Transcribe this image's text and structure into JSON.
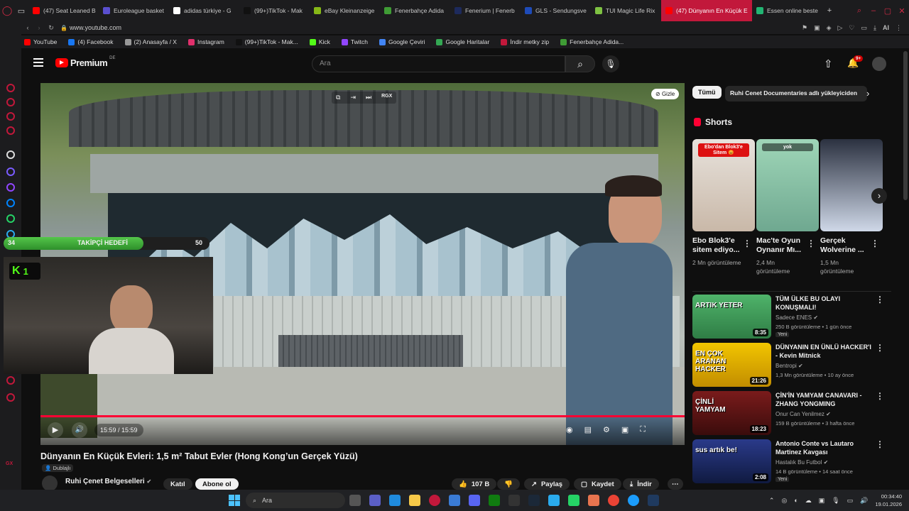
{
  "browser": {
    "tabs": [
      {
        "title": "(47) Seat Leaned B",
        "color": "#ff0000"
      },
      {
        "title": "Euroleague basket",
        "color": "#5a4fcf"
      },
      {
        "title": "adidas türkiye - G",
        "color": "#ffffff"
      },
      {
        "title": "(99+)TikTok - Mak",
        "color": "#111111"
      },
      {
        "title": "eBay Kleinanzeige",
        "color": "#86b817"
      },
      {
        "title": "Fenerbahçe Adida",
        "color": "#3f9c35"
      },
      {
        "title": "Fenerium | Fenerb",
        "color": "#1d2a5c"
      },
      {
        "title": "GLS - Sendungsve",
        "color": "#1e4bb8"
      },
      {
        "title": "TUI Magic Life Rix",
        "color": "#7ec242"
      },
      {
        "title": "(47) Dünyanın En Küçük E",
        "color": "#ff0000"
      },
      {
        "title": "Essen online beste",
        "color": "#22b573"
      }
    ],
    "new_tab": "+",
    "url": "www.youtube.com",
    "bookmarks": [
      "YouTube",
      "(4) Facebook",
      "(2) Anasayfa / X",
      "Instagram",
      "(99+)TikTok - Mak...",
      "Kick",
      "Twitch",
      "Google Çeviri",
      "Google Haritalar",
      "İndir metky zip",
      "Fenerbahçe Adida..."
    ],
    "ai_label": "AI"
  },
  "youtube": {
    "logo_text": "Premium",
    "logo_sup": "DE",
    "search_placeholder": "Ara",
    "notif_count": "9+"
  },
  "player": {
    "overlay_hide": "Gizle",
    "overlay_tag": "RGX",
    "time": "15:59 / 15:59",
    "progress": 1.0
  },
  "stream": {
    "follower_label": "TAKİPÇİ HEDEFİ",
    "follower_current": "34",
    "follower_goal": "50",
    "kick_count": "1"
  },
  "video": {
    "title": "Dünyanın En Küçük Evleri: 1,5 m² Tabut Evler (Hong Kong’un Gerçek Yüzü)",
    "dubbed": "Dublajlı",
    "channel": "Ruhi Çenet Belgeselleri",
    "join": "Katıl",
    "subscribe": "Abone ol",
    "likes": "107 B",
    "share": "Paylaş",
    "save": "Kaydet",
    "download": "İndir"
  },
  "sidebar": {
    "chips": [
      "Tümü",
      "Ruhi Cenet Documentaries adlı yükleyiciden"
    ],
    "shorts_title": "Shorts",
    "shorts": [
      {
        "title": "Ebo Blok3'e sitem ediyo...",
        "views": "2 Mn görüntüleme",
        "thumb_text": "Ebo'dan Blok3'e Sitem 😡"
      },
      {
        "title": "Mac'te Oyun Oynanır Mı...",
        "views": "2,4 Mn görüntüleme",
        "thumb_text": "yok"
      },
      {
        "title": "Gerçek Wolverine ...",
        "views": "1,5 Mn görüntüleme",
        "thumb_text": ""
      }
    ],
    "videos": [
      {
        "title": "TÜM ÜLKE BU OLAYI KONUŞMALI!",
        "channel": "Sadece ENES",
        "meta": "250 B görüntüleme • 1 gün önce",
        "badge": "Yeni",
        "duration": "8:35",
        "thumb_text": "ARTIK YETER"
      },
      {
        "title": "DÜNYANIN EN ÜNLÜ HACKER'I - Kevin Mitnick",
        "channel": "Bentropi",
        "meta": "1,3 Mn görüntüleme • 10 ay önce",
        "badge": "",
        "duration": "21:26",
        "thumb_text": "EN ÇOK ARANAN HACKER"
      },
      {
        "title": "ÇİN'İN YAMYAM CANAVARI - ZHANG YONGMING",
        "channel": "Onur Can Yenilmez",
        "meta": "159 B görüntüleme • 3 hafta önce",
        "badge": "",
        "duration": "18:23",
        "thumb_text": "ÇİNLİ YAMYAM"
      },
      {
        "title": "Antonio Conte vs Lautaro Martinez Kavgası",
        "channel": "Hastalık Bu Futbol",
        "meta": "14 B görüntüleme • 14 saat önce",
        "badge": "Yeni",
        "duration": "2:08",
        "thumb_text": "sus artık be!"
      }
    ]
  },
  "taskbar": {
    "search": "Ara",
    "time": "00:34:40",
    "date": "19.01.2026"
  }
}
